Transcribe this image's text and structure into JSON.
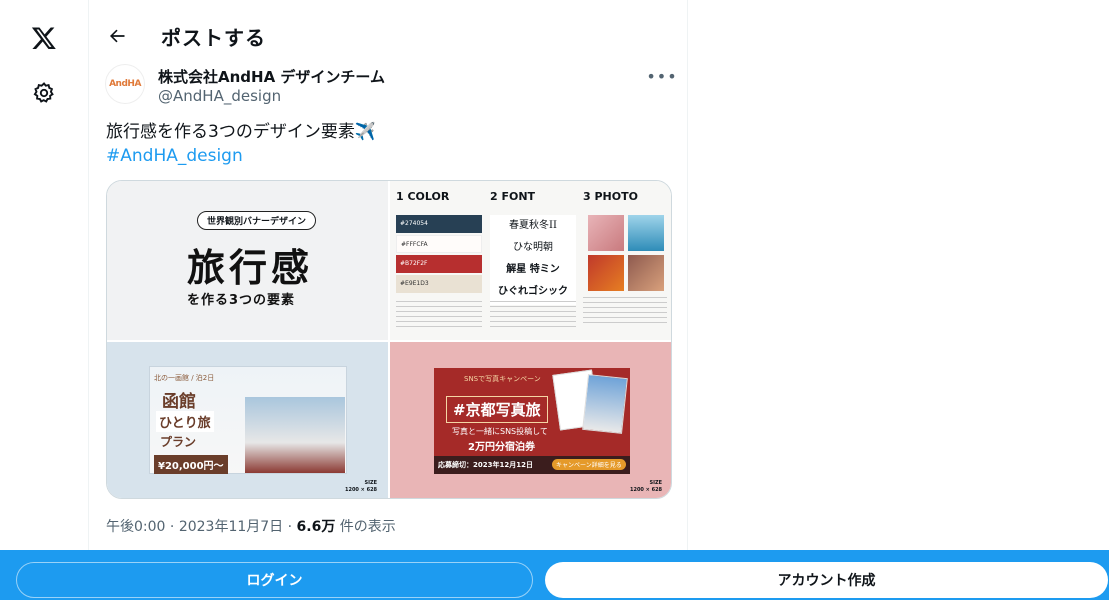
{
  "header": {
    "title": "ポストする"
  },
  "author": {
    "name": "株式会社AndHA デザインチーム",
    "handle": "@AndHA_design",
    "avatar_text": "AndHA"
  },
  "post": {
    "text": "旅行感を作る3つのデザイン要素✈️",
    "hashtag": "#AndHA_design"
  },
  "media": {
    "tile1": {
      "badge": "世界観別バナーデザイン",
      "title": "旅行感",
      "subtitle": "を作る3つの要素"
    },
    "tile2": {
      "col1_head": "1 COLOR",
      "col2_head": "2 FONT",
      "col3_head": "3 PHOTO",
      "swatches": [
        {
          "label": "#274054",
          "color": "#274054"
        },
        {
          "label": "#FFFCFA",
          "color": "#FFFCFA"
        },
        {
          "label": "#B72F2F",
          "color": "#B72F2F"
        },
        {
          "label": "#E9E1D3",
          "color": "#E9E1D3"
        }
      ],
      "fonts": [
        "春夏秋冬II",
        "ひな明朝",
        "解星 特ミン",
        "ひぐれゴシック"
      ]
    },
    "tile3": {
      "tag": "北の一画館 / 泊2日",
      "line1": "函館",
      "line2": "ひとり旅",
      "line3": "プラン",
      "price": "¥20,000円〜",
      "size": "SIZE\n1200 × 628"
    },
    "tile4": {
      "tag": "SNSで写真キャンペーン",
      "title": "#京都写真旅",
      "line1": "写真と一緒にSNS投稿して",
      "line2": "2万円分宿泊券",
      "deadline": "応募締切：2023年12月12日",
      "cta": "キャンペーン詳細を見る",
      "size": "SIZE\n1200 × 628"
    }
  },
  "meta": {
    "time": "午後0:00",
    "date": "2023年11月7日",
    "views": "6.6万",
    "views_label": "件の表示",
    "sep": "·"
  },
  "bottom": {
    "login": "ログイン",
    "signup": "アカウント作成"
  },
  "colors": {
    "accent": "#1d9bf0",
    "text": "#0f1419",
    "muted": "#536471"
  }
}
